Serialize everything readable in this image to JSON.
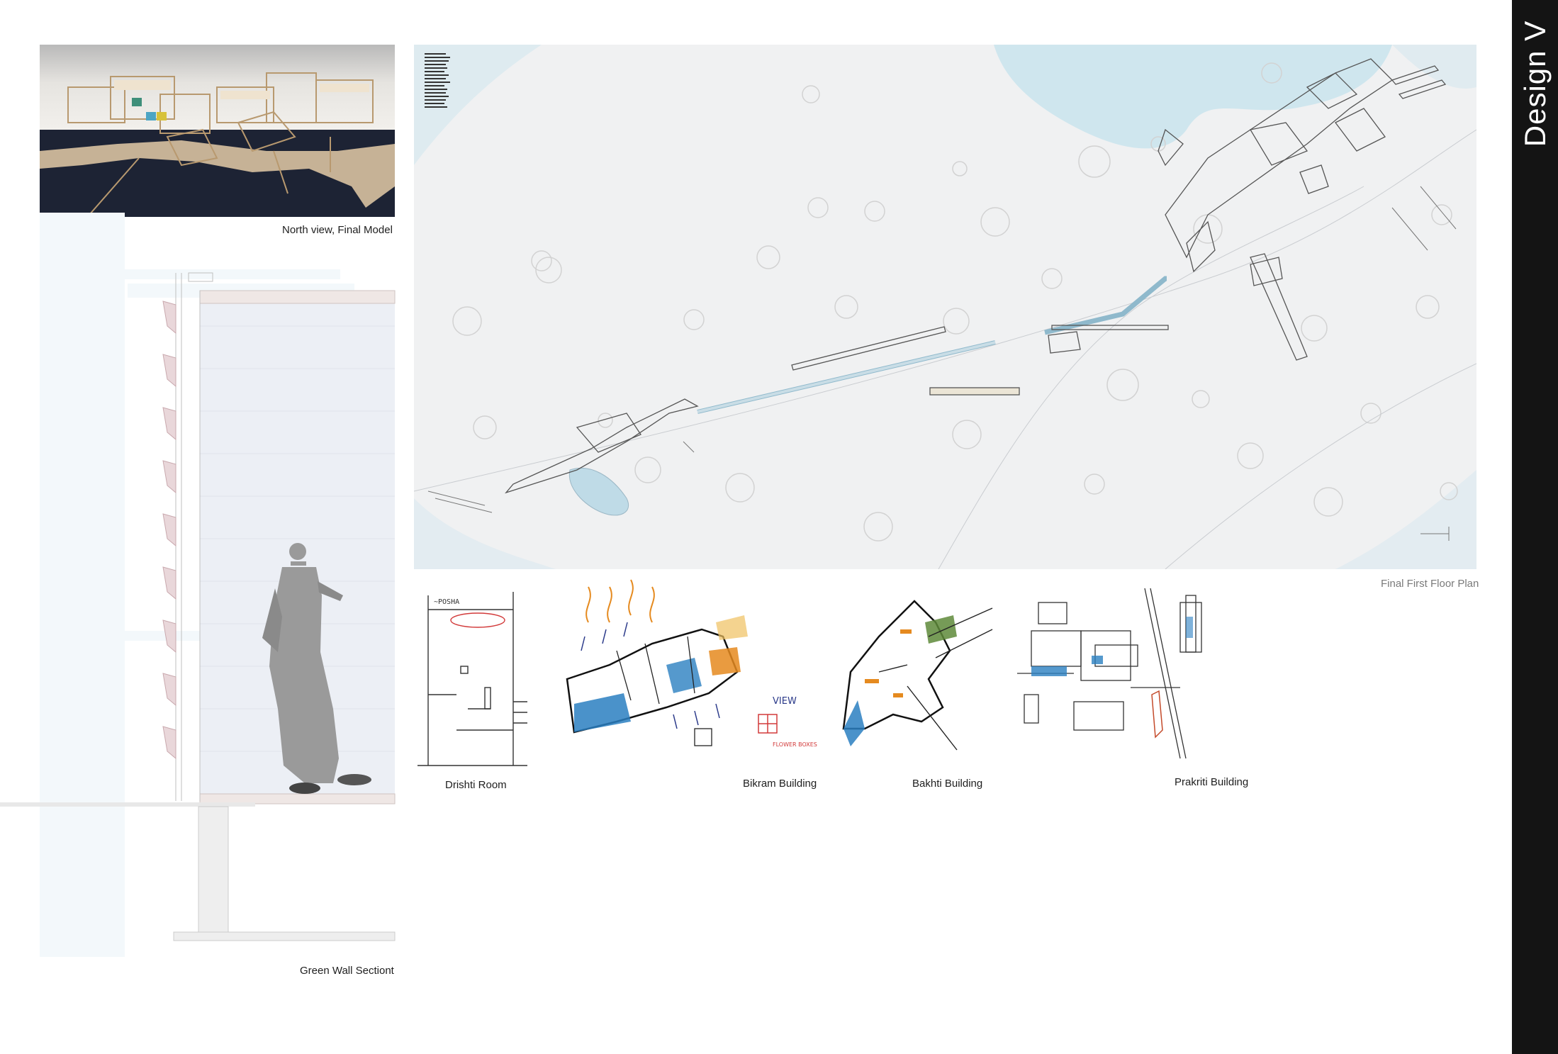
{
  "sidebar": {
    "title": "Design V",
    "background": "#141414"
  },
  "captions": {
    "model": "North view, Final Model",
    "section": "Green Wall Sectiont",
    "plan": "Final First Floor Plan",
    "drishti": "Drishti Room",
    "bikram": "Bikram Building",
    "bakhti": "Bakhti Building",
    "prakriti": "Prakriti Building"
  },
  "sketch_notes": {
    "drishti_label": "~POSHA",
    "bikram_label": "VIEW",
    "bikram_label2": "FLOWER BOXES"
  },
  "colors": {
    "water": "#cfe6ee",
    "model_table": "#1d2334",
    "model_wood": "#d9c2a1",
    "sketch_blue": "#2a7fc1",
    "sketch_orange": "#e58a1f",
    "sketch_green": "#5e8a3a",
    "sketch_red": "#d23a3a"
  }
}
